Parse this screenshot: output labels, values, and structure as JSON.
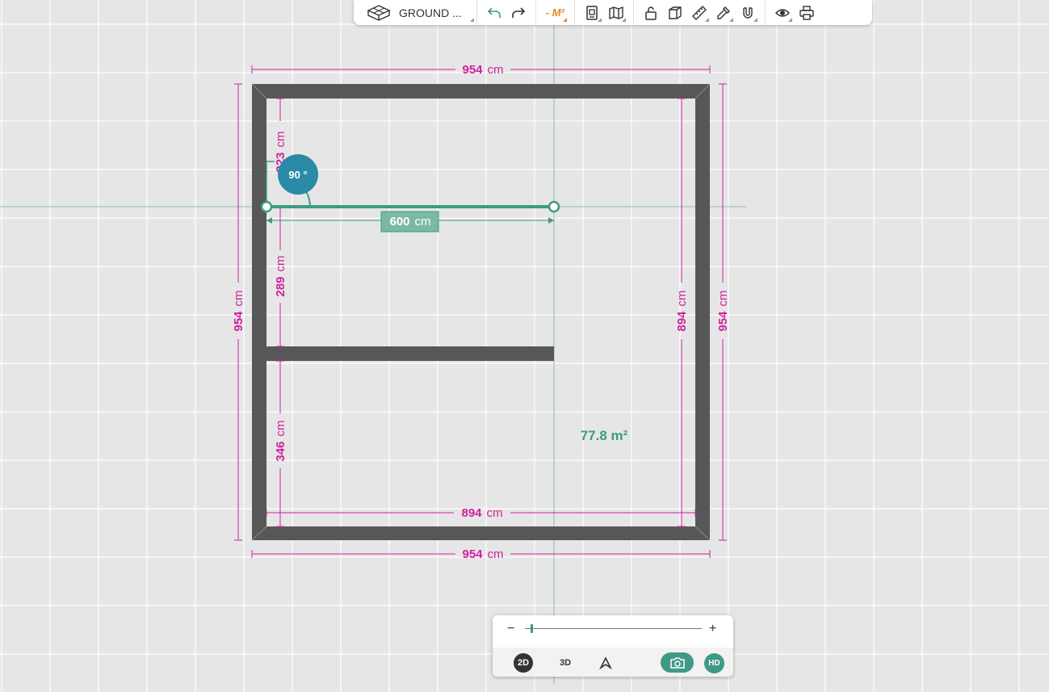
{
  "toolbar": {
    "floor_label": "GROUND ...",
    "area_unit": "- M²"
  },
  "plan": {
    "top_dim": "954",
    "bottom_dim": "954",
    "left_dim": "954",
    "right_outer_dim": "954",
    "right_inner_dim": "894",
    "bottom_inner_dim": "894",
    "seg_top": "223",
    "seg_mid": "289",
    "seg_bottom": "346",
    "unit": "cm",
    "wall_length": "600",
    "angle": "90 °",
    "area": "77.8 m²"
  },
  "zoom": {
    "minus": "−",
    "plus": "+",
    "level": 0.03
  },
  "view": {
    "btn_2d": "2D",
    "btn_3d": "3D",
    "btn_hd": "HD"
  },
  "colors": {
    "wall": "#575757",
    "dimension": "#d0219e",
    "accent": "#3e9a84",
    "angle_badge": "#2b8aa7",
    "orange": "#e8822a"
  }
}
